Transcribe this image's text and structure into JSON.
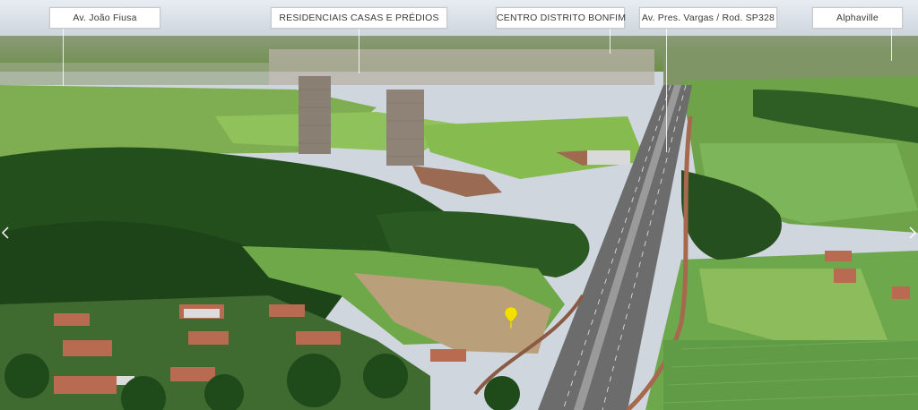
{
  "callouts": [
    {
      "label": "Av. João Fiusa"
    },
    {
      "label": "RESIDENCIAIS CASAS E PRÉDIOS"
    },
    {
      "label": "CENTRO DISTRITO BONFIM"
    },
    {
      "label": "Av. Pres. Vargas / Rod. SP328"
    },
    {
      "label": "Alphaville"
    }
  ],
  "colors": {
    "sky": "#d9e1e8",
    "field": "#7cae4e",
    "forest": "#1f4a1a",
    "road": "#6b6b6b",
    "pin": "#f3e000"
  },
  "icons": {
    "location_pin": "map-pin-icon",
    "prev": "chevron-left-icon",
    "next": "chevron-right-icon"
  }
}
